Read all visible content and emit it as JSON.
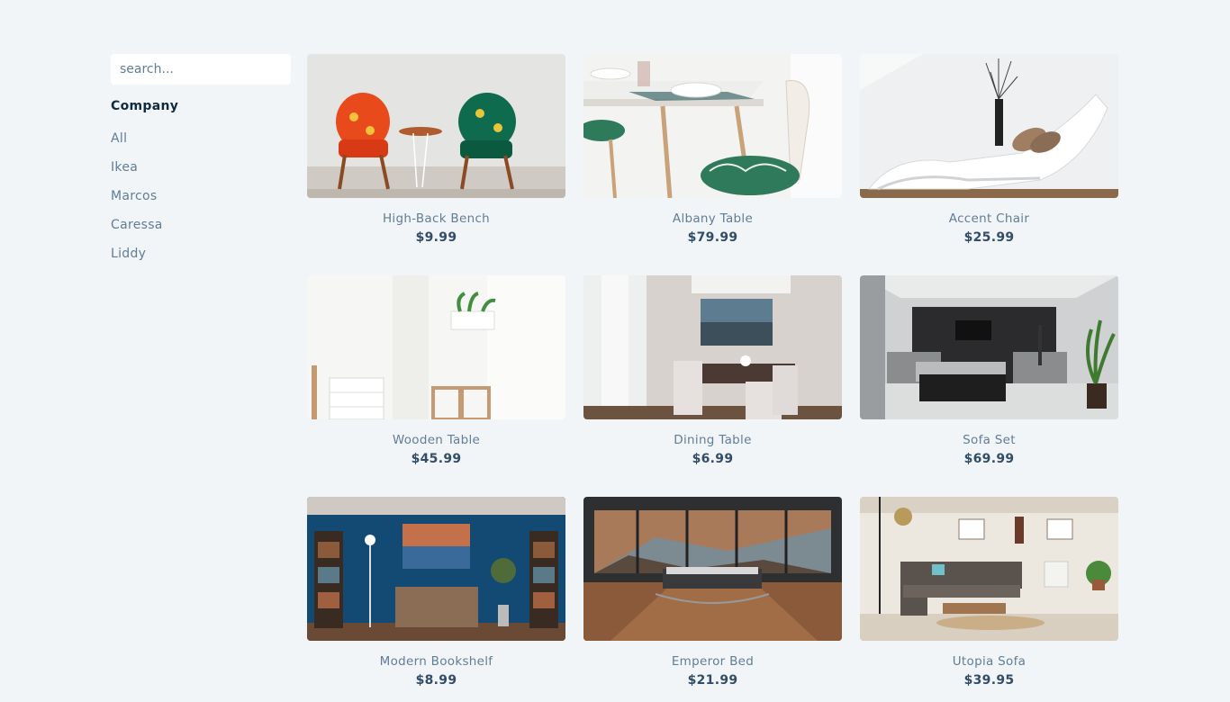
{
  "sidebar": {
    "search_placeholder": "search...",
    "company_title": "Company",
    "companies": [
      "All",
      "Ikea",
      "Marcos",
      "Caressa",
      "Liddy"
    ]
  },
  "products": [
    {
      "name": "High-Back Bench",
      "price": "$9.99"
    },
    {
      "name": "Albany Table",
      "price": "$79.99"
    },
    {
      "name": "Accent Chair",
      "price": "$25.99"
    },
    {
      "name": "Wooden Table",
      "price": "$45.99"
    },
    {
      "name": "Dining Table",
      "price": "$6.99"
    },
    {
      "name": "Sofa Set",
      "price": "$69.99"
    },
    {
      "name": "Modern Bookshelf",
      "price": "$8.99"
    },
    {
      "name": "Emperor Bed",
      "price": "$21.99"
    },
    {
      "name": "Utopia Sofa",
      "price": "$39.95"
    }
  ]
}
